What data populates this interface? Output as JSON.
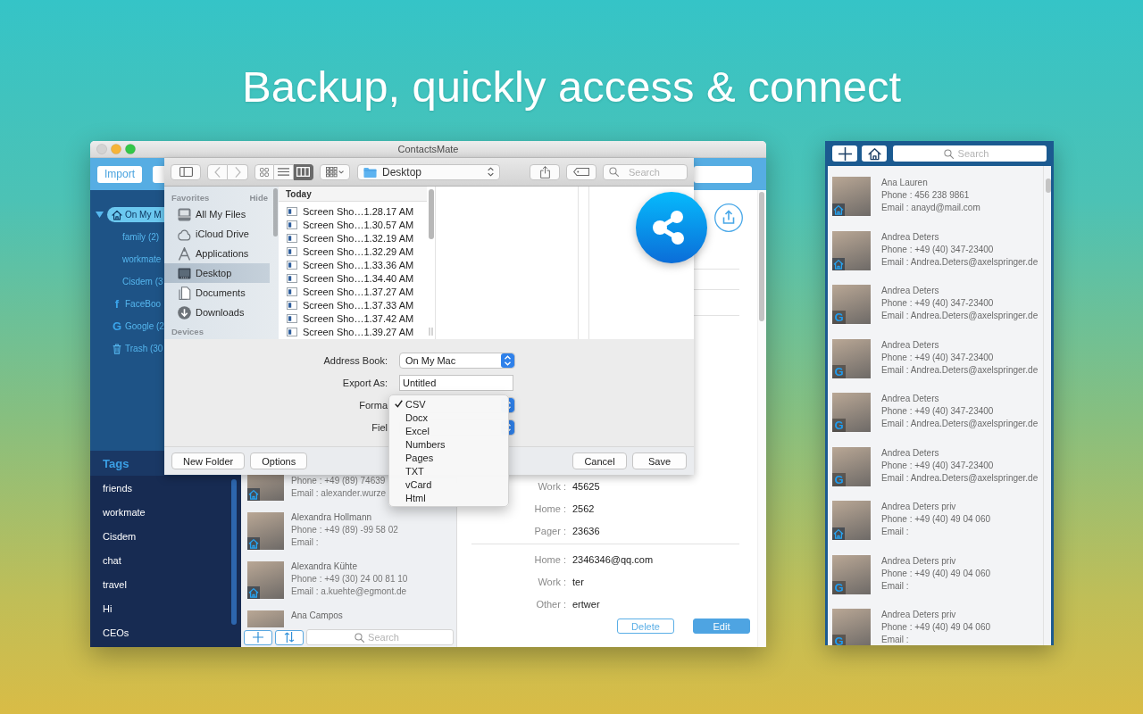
{
  "headline": "Backup, quickly access & connect",
  "main_window": {
    "title": "ContactsMate",
    "window_controls": [
      {
        "kind": "close",
        "disabled": true
      },
      {
        "kind": "minimize",
        "disabled": false
      },
      {
        "kind": "zoom",
        "disabled": false
      }
    ],
    "toolbar": {
      "buttons": [
        "Import"
      ]
    },
    "sidebar": {
      "accounts": [
        {
          "kind": "home",
          "label": "On My M",
          "selected": true,
          "expanded": true,
          "children": [
            {
              "label": "family (2)",
              "selected": false
            },
            {
              "label": "workmate",
              "selected": false
            },
            {
              "label": "Cisdem (3",
              "selected": false
            }
          ]
        },
        {
          "kind": "letter",
          "glyph": "f",
          "label": "FaceBoo",
          "selected": false
        },
        {
          "kind": "letter",
          "glyph": "G",
          "label": "Google (2",
          "selected": false
        },
        {
          "kind": "trash",
          "label": "Trash (30",
          "selected": false
        }
      ],
      "tags_title": "Tags",
      "tags": [
        "friends",
        "workmate",
        "Cisdem",
        "chat",
        "travel",
        "Hi",
        "CEOs"
      ]
    },
    "contacts": [
      {
        "phone": "Phone : +49 (89) 74639",
        "email": "Email : alexander.wurze",
        "kind": "home"
      },
      {
        "name": "Alexandra Hollmann",
        "phone": "Phone : +49 (89) -99 58 02",
        "email": "Email :",
        "kind": "home"
      },
      {
        "name": "Alexandra Kühte",
        "phone": "Phone : +49 (30) 24 00 81 10",
        "email": "Email : a.kuehte@egmont.de",
        "kind": "home"
      },
      {
        "name": "Ana Campos"
      }
    ],
    "search": {
      "placeholder": "Search"
    },
    "detail": {
      "groups": [
        [
          {
            "label": "Work :",
            "value": "45625"
          },
          {
            "label": "Home :",
            "value": "2562"
          },
          {
            "label": "Pager :",
            "value": "23636"
          }
        ],
        [
          {
            "label": "Home :",
            "value": "2346346@qq.com"
          },
          {
            "label": "Work :",
            "value": "ter"
          },
          {
            "label": "Other :",
            "value": "ertwer"
          }
        ]
      ],
      "buttons": [
        {
          "label": "Delete",
          "kind": "secondary"
        },
        {
          "label": "Edit",
          "kind": "primary"
        }
      ]
    }
  },
  "export_dialog": {
    "navigation": [
      {
        "kind": "back",
        "disabled": true
      },
      {
        "kind": "forward",
        "disabled": true
      }
    ],
    "view_modes": [
      {
        "kind": "icons",
        "selected": false
      },
      {
        "kind": "list",
        "selected": false
      },
      {
        "kind": "columns",
        "selected": true
      }
    ],
    "location": "Desktop",
    "search": {
      "placeholder": "Search"
    },
    "sidebar": {
      "sections": [
        {
          "title": "Favorites",
          "action": "Hide",
          "items": [
            {
              "kind": "files",
              "label": "All My Files",
              "selected": false
            },
            {
              "kind": "cloud",
              "label": "iCloud Drive",
              "selected": false
            },
            {
              "kind": "apps",
              "label": "Applications",
              "selected": false
            },
            {
              "kind": "desktop",
              "label": "Desktop",
              "selected": true
            },
            {
              "kind": "documents",
              "label": "Documents",
              "selected": false
            },
            {
              "kind": "downloads",
              "label": "Downloads",
              "selected": false
            }
          ]
        },
        {
          "title": "Devices"
        }
      ]
    },
    "column_header": "Today",
    "files": [
      "Screen Sho…1.28.17 AM",
      "Screen Sho…1.30.57 AM",
      "Screen Sho…1.32.19 AM",
      "Screen Sho…1.32.29 AM",
      "Screen Sho…1.33.36 AM",
      "Screen Sho…1.34.40 AM",
      "Screen Sho…1.37.27 AM",
      "Screen Sho…1.37.33 AM",
      "Screen Sho…1.37.42 AM",
      "Screen Sho…1.39.27 AM"
    ],
    "options": [
      {
        "kind": "popup",
        "label": "Address Book:",
        "value": "On My Mac"
      },
      {
        "kind": "text",
        "label": "Export As:",
        "value": "Untitled"
      },
      {
        "kind": "popup",
        "label": "Forma"
      },
      {
        "kind": "popup",
        "label": "Fiel"
      }
    ],
    "format_menu": [
      {
        "label": "CSV",
        "checked": true
      },
      {
        "label": "Docx",
        "checked": false
      },
      {
        "label": "Excel",
        "checked": false
      },
      {
        "label": "Numbers",
        "checked": false
      },
      {
        "label": "Pages",
        "checked": false
      },
      {
        "label": "TXT",
        "checked": false
      },
      {
        "label": "vCard",
        "checked": false
      },
      {
        "label": "Html",
        "checked": false
      }
    ],
    "left_buttons": [
      "New Folder",
      "Options"
    ],
    "right_buttons": [
      "Cancel",
      "Save"
    ]
  },
  "side_panel": {
    "search": {
      "placeholder": "Search"
    },
    "contacts": [
      {
        "name": "Ana Lauren",
        "phone": "Phone : 456 238 9861",
        "email": "Email : anayd@mail.com",
        "kind": "home"
      },
      {
        "name": "Andrea Deters",
        "phone": "Phone : +49 (40) 347-23400",
        "email": "Email : Andrea.Deters@axelspringer.de",
        "kind": "home"
      },
      {
        "name": "Andrea Deters",
        "phone": "Phone : +49 (40) 347-23400",
        "email": "Email : Andrea.Deters@axelspringer.de",
        "kind": "google",
        "badge": "G"
      },
      {
        "name": "Andrea Deters",
        "phone": "Phone : +49 (40) 347-23400",
        "email": "Email : Andrea.Deters@axelspringer.de",
        "kind": "google",
        "badge": "G"
      },
      {
        "name": "Andrea Deters",
        "phone": "Phone : +49 (40) 347-23400",
        "email": "Email : Andrea.Deters@axelspringer.de",
        "kind": "google",
        "badge": "G"
      },
      {
        "name": "Andrea Deters",
        "phone": "Phone : +49 (40) 347-23400",
        "email": "Email : Andrea.Deters@axelspringer.de",
        "kind": "google",
        "badge": "G"
      },
      {
        "name": "Andrea Deters priv",
        "phone": "Phone : +49 (40) 49 04 060",
        "email": "Email :",
        "kind": "home"
      },
      {
        "name": "Andrea Deters priv",
        "phone": "Phone : +49 (40) 49 04 060",
        "email": "Email :",
        "kind": "google",
        "badge": "G"
      },
      {
        "name": "Andrea Deters priv",
        "phone": "Phone : +49 (40) 49 04 060",
        "email": "Email :",
        "kind": "google",
        "badge": "G"
      }
    ]
  }
}
